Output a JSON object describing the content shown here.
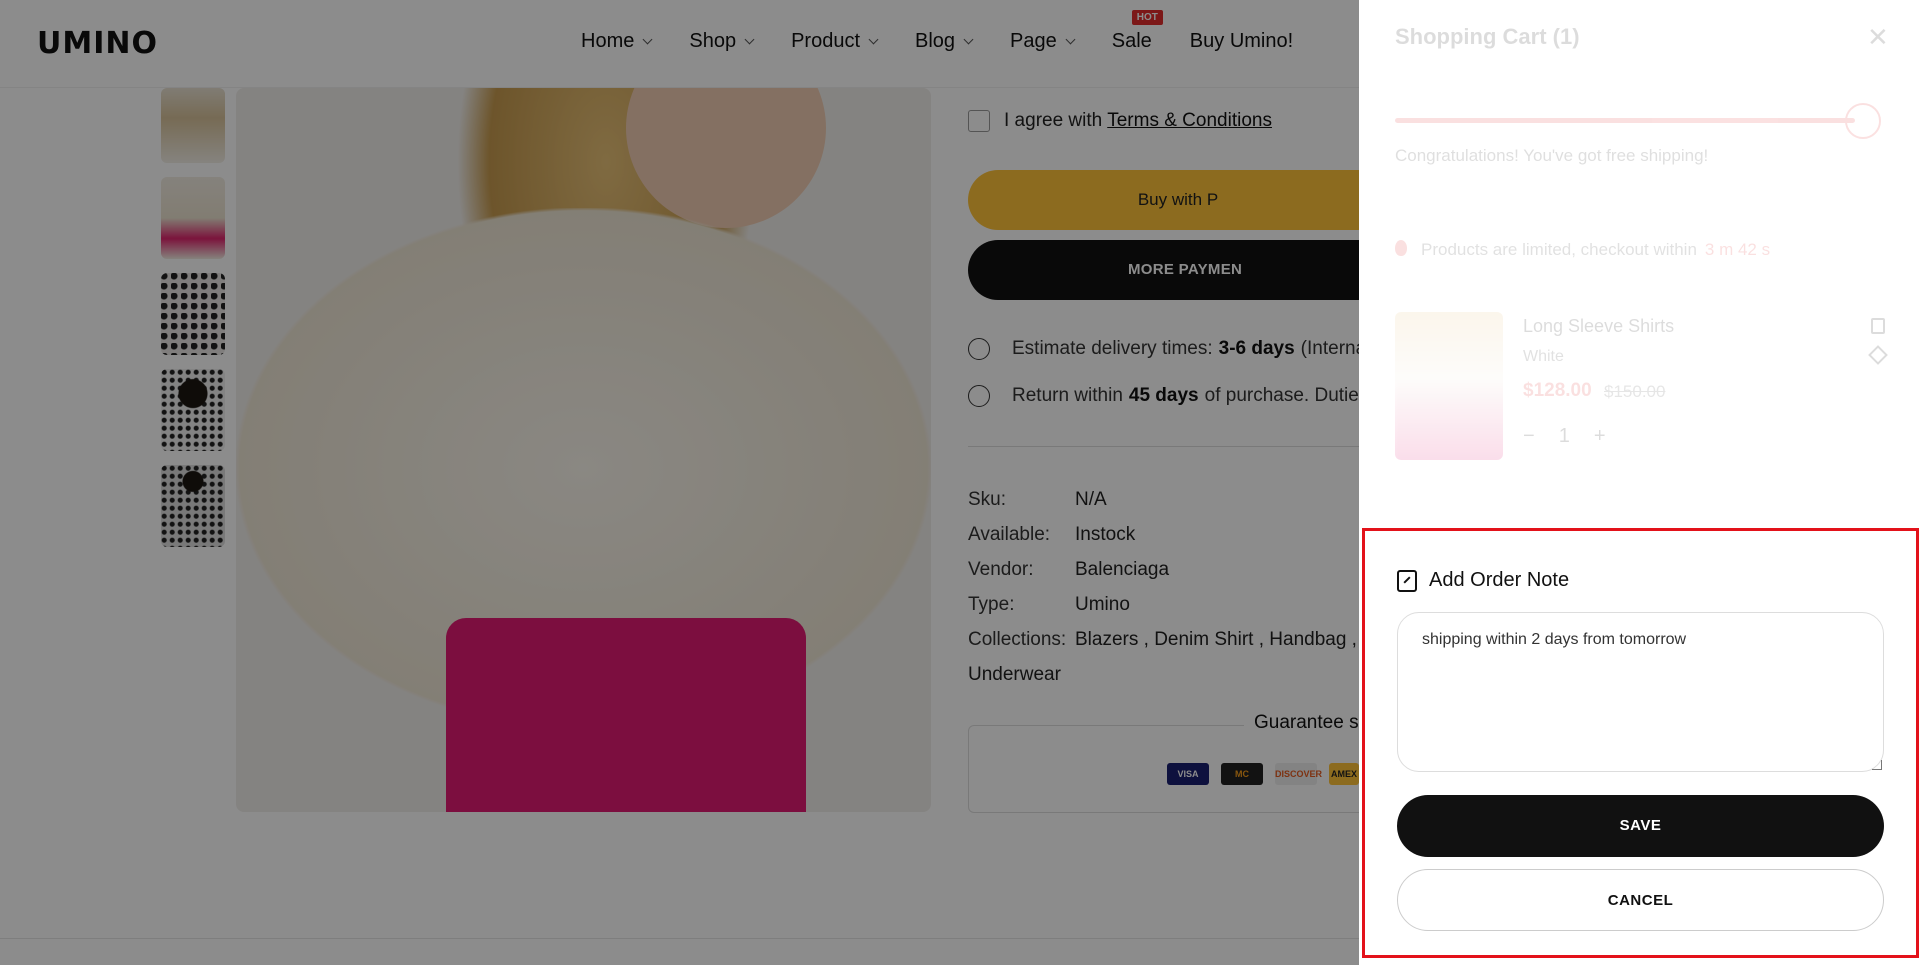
{
  "brand": {
    "logo": "UMINO"
  },
  "nav": {
    "items": [
      {
        "label": "Home",
        "has_dropdown": true
      },
      {
        "label": "Shop",
        "has_dropdown": true
      },
      {
        "label": "Product",
        "has_dropdown": true
      },
      {
        "label": "Blog",
        "has_dropdown": true
      },
      {
        "label": "Page",
        "has_dropdown": true
      },
      {
        "label": "Sale",
        "has_dropdown": false,
        "badge": "HOT"
      },
      {
        "label": "Buy Umino!",
        "has_dropdown": false
      }
    ]
  },
  "product": {
    "agree_prefix": "I agree with",
    "agree_link": "Terms & Conditions",
    "buy_button": "Buy with P",
    "more_payment_button": "MORE PAYMEN",
    "delivery": {
      "prefix": "Estimate delivery times:",
      "value": "3-6 days",
      "suffix": "(Interna"
    },
    "returns": {
      "prefix": "Return within",
      "value": "45 days",
      "suffix": "of purchase. Dutie"
    },
    "meta": [
      {
        "key": "Sku:",
        "value": "N/A"
      },
      {
        "key": "Available:",
        "value": "Instock"
      },
      {
        "key": "Vendor:",
        "value": "Balenciaga"
      },
      {
        "key": "Type:",
        "value": "Umino"
      },
      {
        "key": "Collections:",
        "value": "Blazers , Denim Shirt , Handbag ,"
      }
    ],
    "collections_overflow": "Underwear",
    "guarantee_title": "Guarantee sa",
    "payment_cards": [
      "VISA",
      "MC",
      "DISCOVER",
      "AMEX"
    ]
  },
  "cart": {
    "title": "Shopping Cart (1)",
    "close_icon": "close-icon",
    "free_shipping_text": "Congratulations! You've got free shipping!",
    "free_shipping_progress": 1.0,
    "limited_text": "Products are limited, checkout within",
    "timer": "3 m 42 s",
    "item": {
      "name": "Long Sleeve Shirts",
      "variant": "White",
      "price": "$128.00",
      "compare_price": "$150.00",
      "quantity": "1"
    }
  },
  "order_note": {
    "title": "Add Order Note",
    "note_value": "shipping within 2 days from tomorrow",
    "save_label": "SAVE",
    "cancel_label": "CANCEL"
  },
  "colors": {
    "accent_red": "#e22d2d",
    "highlight_border": "#e3121a",
    "button_dark": "#111111",
    "paypal_yellow": "#ffc43a"
  }
}
